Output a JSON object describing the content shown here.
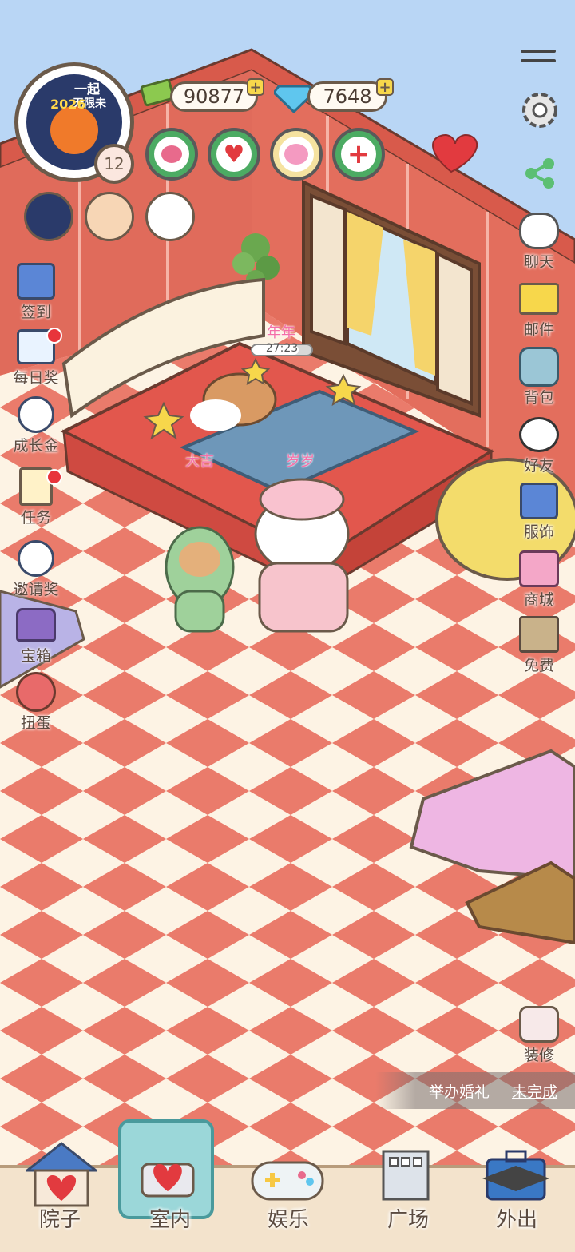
{
  "hud": {
    "coins": "90877",
    "gems": "7648",
    "level": "12",
    "avatar_banner_text": "一起",
    "avatar_banner_text2": "无限未",
    "avatar_year": "2026"
  },
  "left_menu": [
    {
      "key": "checkin",
      "label": "签到",
      "icon": "calendar-check-icon",
      "dot": false
    },
    {
      "key": "daily",
      "label": "每日奖",
      "icon": "video-reward-icon",
      "dot": true
    },
    {
      "key": "growth",
      "label": "成长金",
      "icon": "panda-coins-icon",
      "dot": false
    },
    {
      "key": "tasks",
      "label": "任务",
      "icon": "task-clipboard-icon",
      "dot": true
    },
    {
      "key": "invite",
      "label": "邀请奖",
      "icon": "panda-gift-icon",
      "dot": false
    },
    {
      "key": "chest",
      "label": "宝箱",
      "icon": "treasure-chest-icon",
      "dot": false
    },
    {
      "key": "gacha",
      "label": "扭蛋",
      "icon": "gacha-egg-icon",
      "dot": false
    }
  ],
  "right_menu": [
    {
      "key": "chat",
      "label": "聊天",
      "icon": "chat-bubble-icon"
    },
    {
      "key": "mail",
      "label": "邮件",
      "icon": "mail-envelope-icon"
    },
    {
      "key": "bag",
      "label": "背包",
      "icon": "backpack-icon"
    },
    {
      "key": "friends",
      "label": "好友",
      "icon": "panda-friends-icon"
    },
    {
      "key": "outfit",
      "label": "服饰",
      "icon": "clothing-icon"
    },
    {
      "key": "shop",
      "label": "商城",
      "icon": "shop-store-icon"
    },
    {
      "key": "free",
      "label": "免费",
      "icon": "house-free-icon"
    }
  ],
  "decorate_label": "装修",
  "characters": {
    "sleeping_name": "年年",
    "sleep_timer": "27:23",
    "left_char": "大吉",
    "right_char": "岁岁"
  },
  "quest": {
    "title": "举办婚礼",
    "status": "未完成"
  },
  "bottom_nav": [
    {
      "key": "yard",
      "label": "院子",
      "active": false
    },
    {
      "key": "indoor",
      "label": "室内",
      "active": true
    },
    {
      "key": "fun",
      "label": "娱乐",
      "active": false
    },
    {
      "key": "plaza",
      "label": "广场",
      "active": false
    },
    {
      "key": "outing",
      "label": "外出",
      "active": false
    }
  ],
  "colors": {
    "wall": "#e06b5b",
    "floor_red": "#ea7b6b",
    "floor_cream": "#fdf3e4",
    "sky": "#b9d6f5",
    "accent_green": "#4cab63"
  }
}
